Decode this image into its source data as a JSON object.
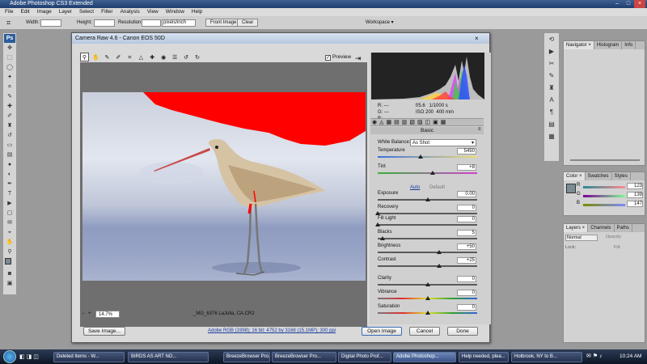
{
  "app": {
    "title": "Adobe Photoshop CS3 Extended"
  },
  "menu": [
    "File",
    "Edit",
    "Image",
    "Layer",
    "Select",
    "Filter",
    "Analysis",
    "View",
    "Window",
    "Help"
  ],
  "options_bar": {
    "width_label": "Width:",
    "height_label": "Height:",
    "resolution_label": "Resolution:",
    "res_unit": "pixels/inch",
    "front_image": "Front Image",
    "clear": "Clear",
    "workspace": "Workspace ▾"
  },
  "dialog": {
    "title": "Camera Raw 4.6  -  Canon EOS 50D",
    "preview_label": "Preview",
    "zoom": "14.7%",
    "filename": "_MG_6376 LaJolla, CA.CR2",
    "workflow_link": "Adobe RGB (1998); 16 bit; 4752 by 3168 (15.1MP); 300 ppi",
    "buttons": {
      "save": "Save Image...",
      "open": "Open Image",
      "cancel": "Cancel",
      "done": "Done"
    }
  },
  "histogram_readout": {
    "r": "R:",
    "g": "G:",
    "b": "B:",
    "r_val": "---",
    "g_val": "---",
    "b_val": "---",
    "aperture": "f/5.6",
    "shutter": "1/1000 s",
    "iso": "ISO 200",
    "focal": "400 mm"
  },
  "basic": {
    "section": "Basic",
    "wb_label": "White Balance:",
    "wb_value": "As Shot",
    "auto": "Auto",
    "default": "Default",
    "sliders": [
      {
        "label": "Temperature",
        "value": "5450",
        "pos": 0.43
      },
      {
        "label": "Tint",
        "value": "+8",
        "pos": 0.55
      },
      {
        "label": "Exposure",
        "value": "0.00",
        "pos": 0.5
      },
      {
        "label": "Recovery",
        "value": "0",
        "pos": 0
      },
      {
        "label": "Fill Light",
        "value": "0",
        "pos": 0
      },
      {
        "label": "Blacks",
        "value": "5",
        "pos": 0.05
      },
      {
        "label": "Brightness",
        "value": "+50",
        "pos": 0.62
      },
      {
        "label": "Contrast",
        "value": "+25",
        "pos": 0.62
      },
      {
        "label": "Clarity",
        "value": "0",
        "pos": 0.5
      },
      {
        "label": "Vibrance",
        "value": "0",
        "pos": 0.5
      },
      {
        "label": "Saturation",
        "value": "0",
        "pos": 0.5
      }
    ]
  },
  "panels": {
    "navigator_tabs": [
      "Navigator ×",
      "Histogram",
      "Info"
    ],
    "color_tabs": [
      "Color ×",
      "Swatches",
      "Styles"
    ],
    "color_values": [
      {
        "ch": "R",
        "val": "123"
      },
      {
        "ch": "G",
        "val": "139"
      },
      {
        "ch": "B",
        "val": "147"
      }
    ],
    "layers_tabs": [
      "Layers ×",
      "Channels",
      "Paths"
    ],
    "blend_mode": "Normal",
    "opacity_label": "Opacity:",
    "lock_label": "Lock:",
    "fill_label": "Fill:"
  },
  "taskbar": {
    "items": [
      "Deleted Items - W...",
      "BIRDS AS ART NO...",
      "BreezeBrowser Pro...",
      "BreezeBrowser Pro...",
      "Digital Photo Prof...",
      "Adobe Photoshop...",
      "Help needed, plea...",
      "Holbrook, NY to B..."
    ],
    "clock": "10:24 AM"
  }
}
